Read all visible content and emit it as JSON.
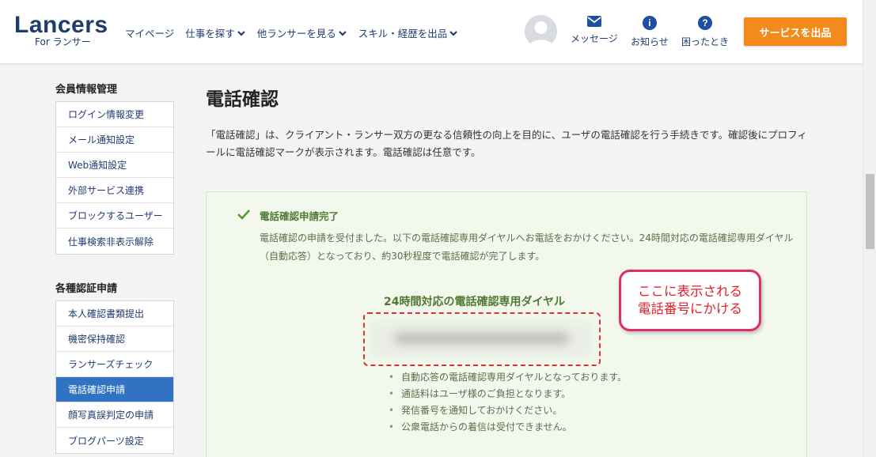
{
  "header": {
    "logo_main": "Lancers",
    "logo_sub": "For ランサー",
    "nav": [
      {
        "label": "マイページ",
        "has_dropdown": false
      },
      {
        "label": "仕事を探す",
        "has_dropdown": true
      },
      {
        "label": "他ランサーを見る",
        "has_dropdown": true
      },
      {
        "label": "スキル・経歴を出品",
        "has_dropdown": true
      }
    ],
    "icons": [
      {
        "label": "メッセージ",
        "icon": "mail-icon"
      },
      {
        "label": "お知らせ",
        "icon": "info-icon"
      },
      {
        "label": "困ったとき",
        "icon": "help-icon"
      }
    ],
    "service_button": "サービスを出品"
  },
  "sidebar": {
    "section1_title": "会員情報管理",
    "section1_items": [
      "ログイン情報変更",
      "メール通知設定",
      "Web通知設定",
      "外部サービス連携",
      "ブロックするユーザー",
      "仕事検索非表示解除"
    ],
    "section2_title": "各種認証申請",
    "section2_items": [
      "本人確認書類提出",
      "機密保持確認",
      "ランサーズチェック",
      "電話確認申請",
      "顔写真誤判定の申請",
      "ブログパーツ設定"
    ],
    "active_item": "電話確認申請"
  },
  "main": {
    "title": "電話確認",
    "intro": "「電話確認」は、クライアント・ランサー双方の更なる信頼性の向上を目的に、ユーザの電話確認を行う手続きです。確認後にプロフィールに電話確認マークが表示されます。電話確認は任意です。",
    "panel": {
      "heading": "電話確認申請完了",
      "description": "電話確認の申請を受付ました。以下の電話確認専用ダイヤルへお電話をおかけください。24時間対応の電話確認専用ダイヤル（自動応答）となっており、約30秒程度で電話確認が完了します。",
      "dial_title": "24時間対応の電話確認専用ダイヤル",
      "notes": [
        "自動応答の電話確認専用ダイヤルとなっております。",
        "通話料はユーザ様のご負担となります。",
        "発信番号を通知しておかけください。",
        "公衆電話からの着信は受付できません。"
      ]
    }
  },
  "callout": {
    "line1": "ここに表示される",
    "line2": "電話番号にかける"
  },
  "colors": {
    "brand_navy": "#1f3c6e",
    "accent_orange": "#f28a1c",
    "active_blue": "#2f73c2",
    "panel_green": "#f2f8ec",
    "annotation_red": "#e02c2c"
  }
}
